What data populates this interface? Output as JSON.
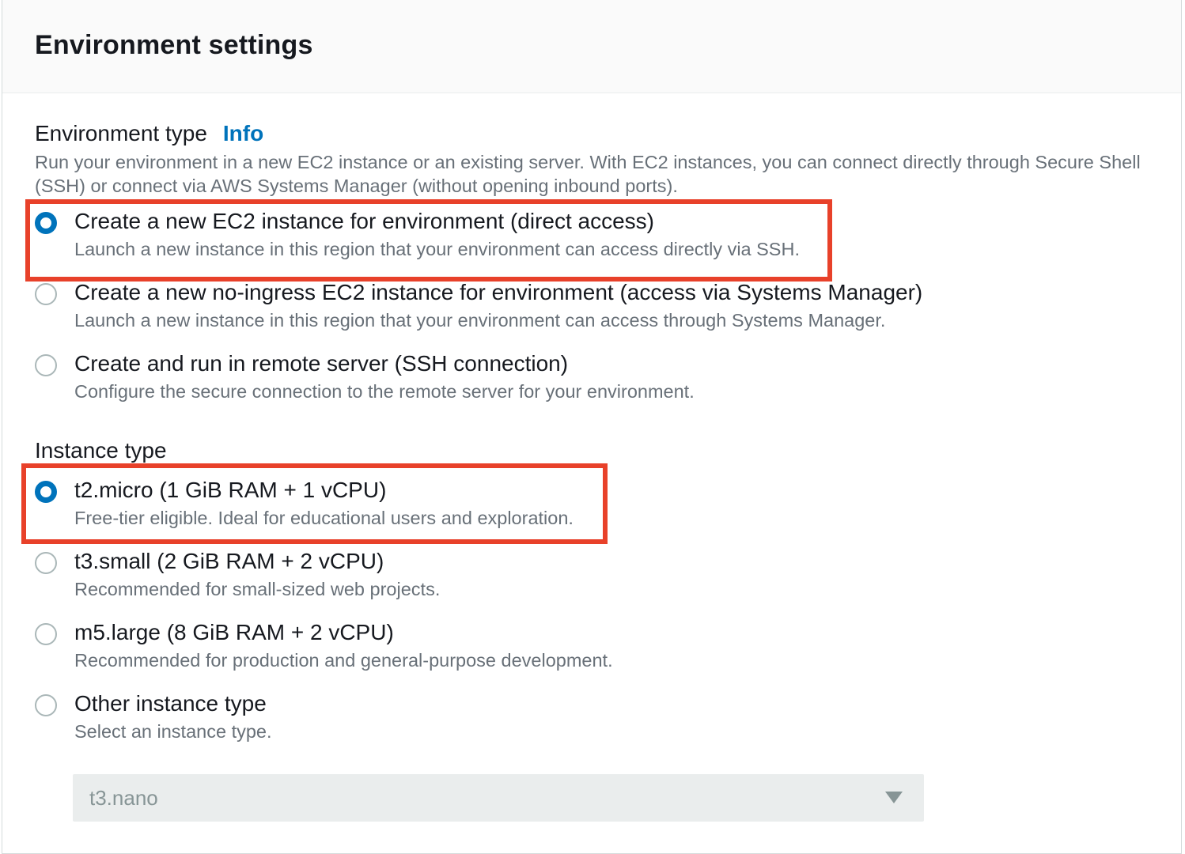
{
  "panel": {
    "title": "Environment settings"
  },
  "environment_type": {
    "label": "Environment type",
    "info_link": "Info",
    "description": "Run your environment in a new EC2 instance or an existing server. With EC2 instances, you can connect directly through Secure Shell (SSH) or connect via AWS Systems Manager (without opening inbound ports).",
    "options": [
      {
        "label": "Create a new EC2 instance for environment (direct access)",
        "description": "Launch a new instance in this region that your environment can access directly via SSH.",
        "selected": true
      },
      {
        "label": "Create a new no-ingress EC2 instance for environment (access via Systems Manager)",
        "description": "Launch a new instance in this region that your environment can access through Systems Manager.",
        "selected": false
      },
      {
        "label": "Create and run in remote server (SSH connection)",
        "description": "Configure the secure connection to the remote server for your environment.",
        "selected": false
      }
    ]
  },
  "instance_type": {
    "label": "Instance type",
    "options": [
      {
        "label": "t2.micro (1 GiB RAM + 1 vCPU)",
        "description": "Free-tier eligible. Ideal for educational users and exploration.",
        "selected": true
      },
      {
        "label": "t3.small (2 GiB RAM + 2 vCPU)",
        "description": "Recommended for small-sized web projects.",
        "selected": false
      },
      {
        "label": "m5.large (8 GiB RAM + 2 vCPU)",
        "description": "Recommended for production and general-purpose development.",
        "selected": false
      },
      {
        "label": "Other instance type",
        "description": "Select an instance type.",
        "selected": false
      }
    ],
    "other_select": {
      "value": "t3.nano",
      "disabled": true
    }
  },
  "colors": {
    "accent": "#0073bb",
    "highlight": "#e8412a",
    "text_primary": "#16191f",
    "text_secondary": "#687078",
    "header_bg": "#fafafa",
    "select_disabled_bg": "#eaeded"
  }
}
